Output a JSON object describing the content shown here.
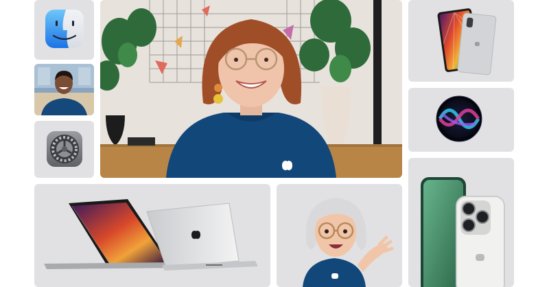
{
  "tiles": [
    {
      "id": "finder-tile",
      "icon": "finder-app-icon"
    },
    {
      "id": "facetime-call-tile",
      "icon": "facetime-participant-photo"
    },
    {
      "id": "system-preferences-tile",
      "icon": "system-preferences-gear-icon"
    },
    {
      "id": "featured-presenter-tile",
      "icon": "presenter-photo"
    },
    {
      "id": "ipad-pro-tile",
      "icon": "ipad-pro-device"
    },
    {
      "id": "siri-tile",
      "icon": "siri-orb-icon"
    },
    {
      "id": "iphone-13-pro-tile",
      "icon": "iphone-device"
    },
    {
      "id": "macbook-pro-tile",
      "icon": "macbook-pro-device"
    },
    {
      "id": "memoji-tile",
      "icon": "memoji-avatar"
    }
  ],
  "colors": {
    "tile_background": "#e1e1e3",
    "apple_shirt_blue": "#12477a",
    "finder_blue": "#2e7ee6",
    "iphone_green": "#3b7a5a"
  }
}
